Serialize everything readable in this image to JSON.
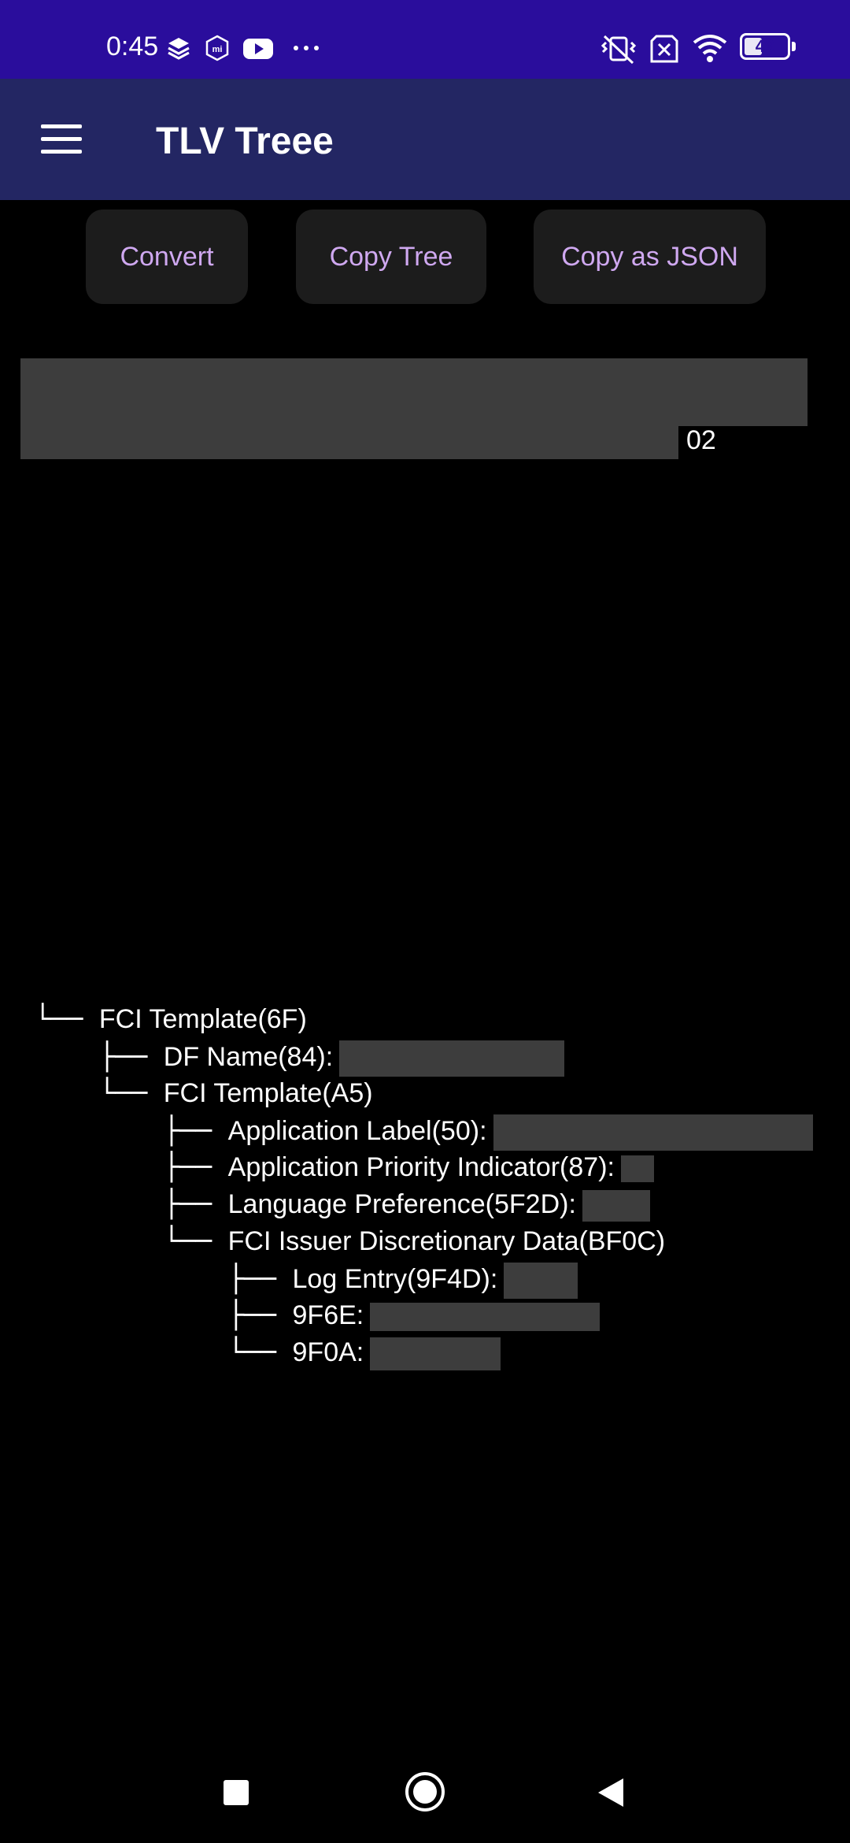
{
  "status_bar": {
    "time": "0:45",
    "left_icons": [
      "layers-icon",
      "mi-icon",
      "youtube-icon",
      "more-dots-icon"
    ],
    "right_icons": [
      "vibrate-off-icon",
      "no-sim-icon",
      "wifi-icon"
    ],
    "battery": "49",
    "battery_level": 0.49
  },
  "app_bar": {
    "title": "TLV Treee",
    "menu_icon": "menu-icon"
  },
  "actions": {
    "convert": "Convert",
    "copy_tree": "Copy Tree",
    "copy_json": "Copy as JSON"
  },
  "input": {
    "visible_tail": "02"
  },
  "tree": [
    {
      "prefix": "└── ",
      "label": "FCI Template(6F)"
    },
    {
      "prefix": "    ├── ",
      "label": "DF Name(84):"
    },
    {
      "prefix": "    └── ",
      "label": "FCI Template(A5)"
    },
    {
      "prefix": "        ├── ",
      "label": "Application Label(50):"
    },
    {
      "prefix": "        ├── ",
      "label": "Application Priority Indicator(87):"
    },
    {
      "prefix": "        ├── ",
      "label": "Language Preference(5F2D):"
    },
    {
      "prefix": "        └── ",
      "label": "FCI Issuer Discretionary Data(BF0C)"
    },
    {
      "prefix": "            ├── ",
      "label": "Log Entry(9F4D):"
    },
    {
      "prefix": "            ├── ",
      "label": "9F6E:"
    },
    {
      "prefix": "            └── ",
      "label": "9F0A:"
    }
  ],
  "nav_bar": {
    "icons": [
      "recents-square-icon",
      "home-circle-icon",
      "back-triangle-icon"
    ]
  }
}
